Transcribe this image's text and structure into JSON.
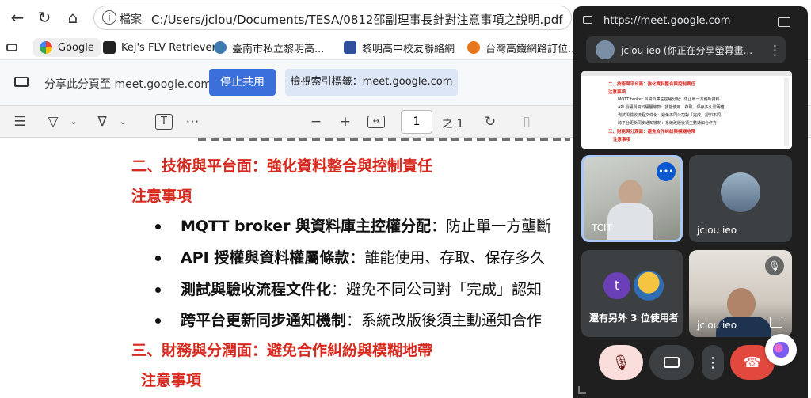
{
  "browser": {
    "url_scheme_label": "檔案",
    "url": "C:/Users/jclou/Documents/TESA/0812邵副理事長針對注意事項之說明.pdf"
  },
  "bookmarks": [
    {
      "label": "Google"
    },
    {
      "label": "Kej's FLV Retriever"
    },
    {
      "label": "臺南市私立黎明高..."
    },
    {
      "label": "黎明高中校友聯絡網"
    },
    {
      "label": "台灣高鐵網路訂位..."
    }
  ],
  "share_bar": {
    "message": "分享此分頁至 meet.google.com",
    "stop_label": "停止共用",
    "view_label": "檢視索引標籤：meet.google.com"
  },
  "pdf_toolbar": {
    "page_value": "1",
    "page_total": "之 1"
  },
  "pdf": {
    "heading2": "二、技術與平台面：強化資料整合與控制責任",
    "note_label": "注意事項",
    "bullets": [
      {
        "bold": "MQTT broker 與資料庫主控權分配",
        "rest": "：防止單一方壟斷"
      },
      {
        "bold": "API 授權與資料權屬條款",
        "rest": "：誰能使用、存取、保存多久"
      },
      {
        "bold": "測試與驗收流程文件化",
        "rest": "：避免不同公司對「完成」認知"
      },
      {
        "bold": "跨平台更新同步通知機制",
        "rest": "：系統改版後須主動通知合作"
      }
    ],
    "heading3": "三、財務與分潤面：避免合作糾紛與模糊地帶",
    "note_label2": "注意事項"
  },
  "meet": {
    "url": "https://meet.google.com",
    "presenter_label": "jclou ieo (你正在分享螢幕畫...",
    "thumb_lines": [
      "二、技術與平台面：強化資料整合與控制責任",
      "注意事項",
      "MQTT broker 與資料庫主控權分配：防止單一方壟斷資料",
      "API 授權與資料權屬條款：誰能使用、存取、保存多久需明確",
      "測試與驗收流程文件化：避免不同公司對「完成」認知不同",
      "跨平台更新同步通知機制：系統改版後須主動通知合作方",
      "三、財務與分潤面：避免合作糾紛與模糊地帶",
      "注意事項"
    ],
    "tiles": [
      {
        "name": "TCIT"
      },
      {
        "name": "jclou ieo"
      },
      {
        "name": "還有另外 3 位使用者",
        "avatar_letter": "t"
      },
      {
        "name": "jclou ieo"
      }
    ]
  },
  "colors": {
    "accent_blue": "#3b6fd9",
    "heading_red": "#d62a1f",
    "end_call_red": "#e2483d",
    "meet_bg": "#1f1f1f"
  }
}
